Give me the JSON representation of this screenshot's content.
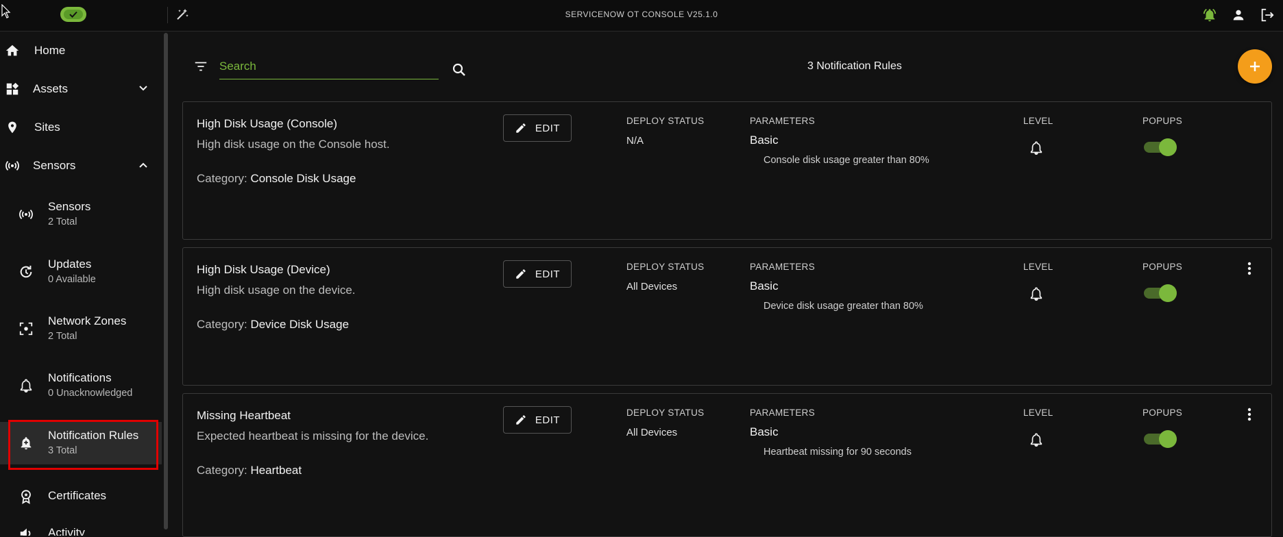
{
  "app": {
    "title": "SERVICENOW OT CONSOLE V25.1.0"
  },
  "colors": {
    "accent_green": "#7bb83c",
    "fab_orange": "#f49d1a",
    "highlight_red": "#e00000"
  },
  "sidebar": {
    "items": [
      {
        "label": "Home",
        "icon": "home-icon"
      },
      {
        "label": "Assets",
        "icon": "assets-icon",
        "expanded": false
      },
      {
        "label": "Sites",
        "icon": "location-pin-icon"
      },
      {
        "label": "Sensors",
        "icon": "sensor-broadcast-icon",
        "expanded": true
      }
    ],
    "sub_items": [
      {
        "label": "Sensors",
        "sub": "2 Total",
        "icon": "sensor-broadcast-icon"
      },
      {
        "label": "Updates",
        "sub": "0 Available",
        "icon": "update-icon"
      },
      {
        "label": "Network Zones",
        "sub": "2 Total",
        "icon": "network-zone-icon"
      },
      {
        "label": "Notifications",
        "sub": "0 Unacknowledged",
        "icon": "bell-icon"
      },
      {
        "label": "Notification Rules",
        "sub": "3 Total",
        "icon": "bell-plus-icon",
        "active": true
      },
      {
        "label": "Certificates",
        "icon": "certificate-icon"
      },
      {
        "label": "Activity",
        "icon": "activity-icon"
      }
    ]
  },
  "toolbar": {
    "search_placeholder": "Search",
    "rules_count": "3 Notification Rules"
  },
  "columns": {
    "deploy": "DEPLOY STATUS",
    "parameters": "PARAMETERS",
    "level": "LEVEL",
    "popups": "POPUPS"
  },
  "edit_label": "EDIT",
  "category_label": "Category:",
  "rules": [
    {
      "name": "High Disk Usage (Console)",
      "description": "High disk usage on the Console host.",
      "category": "Console Disk Usage",
      "deploy_status": "N/A",
      "param_name": "Basic",
      "param_desc": "Console disk usage greater than 80%",
      "popups_enabled": true,
      "has_menu": false
    },
    {
      "name": "High Disk Usage (Device)",
      "description": "High disk usage on the device.",
      "category": "Device Disk Usage",
      "deploy_status": "All Devices",
      "param_name": "Basic",
      "param_desc": "Device disk usage greater than 80%",
      "popups_enabled": true,
      "has_menu": true
    },
    {
      "name": "Missing Heartbeat",
      "description": "Expected heartbeat is missing for the device.",
      "category": "Heartbeat",
      "deploy_status": "All Devices",
      "param_name": "Basic",
      "param_desc": "Heartbeat missing for 90 seconds",
      "popups_enabled": true,
      "has_menu": true
    }
  ]
}
